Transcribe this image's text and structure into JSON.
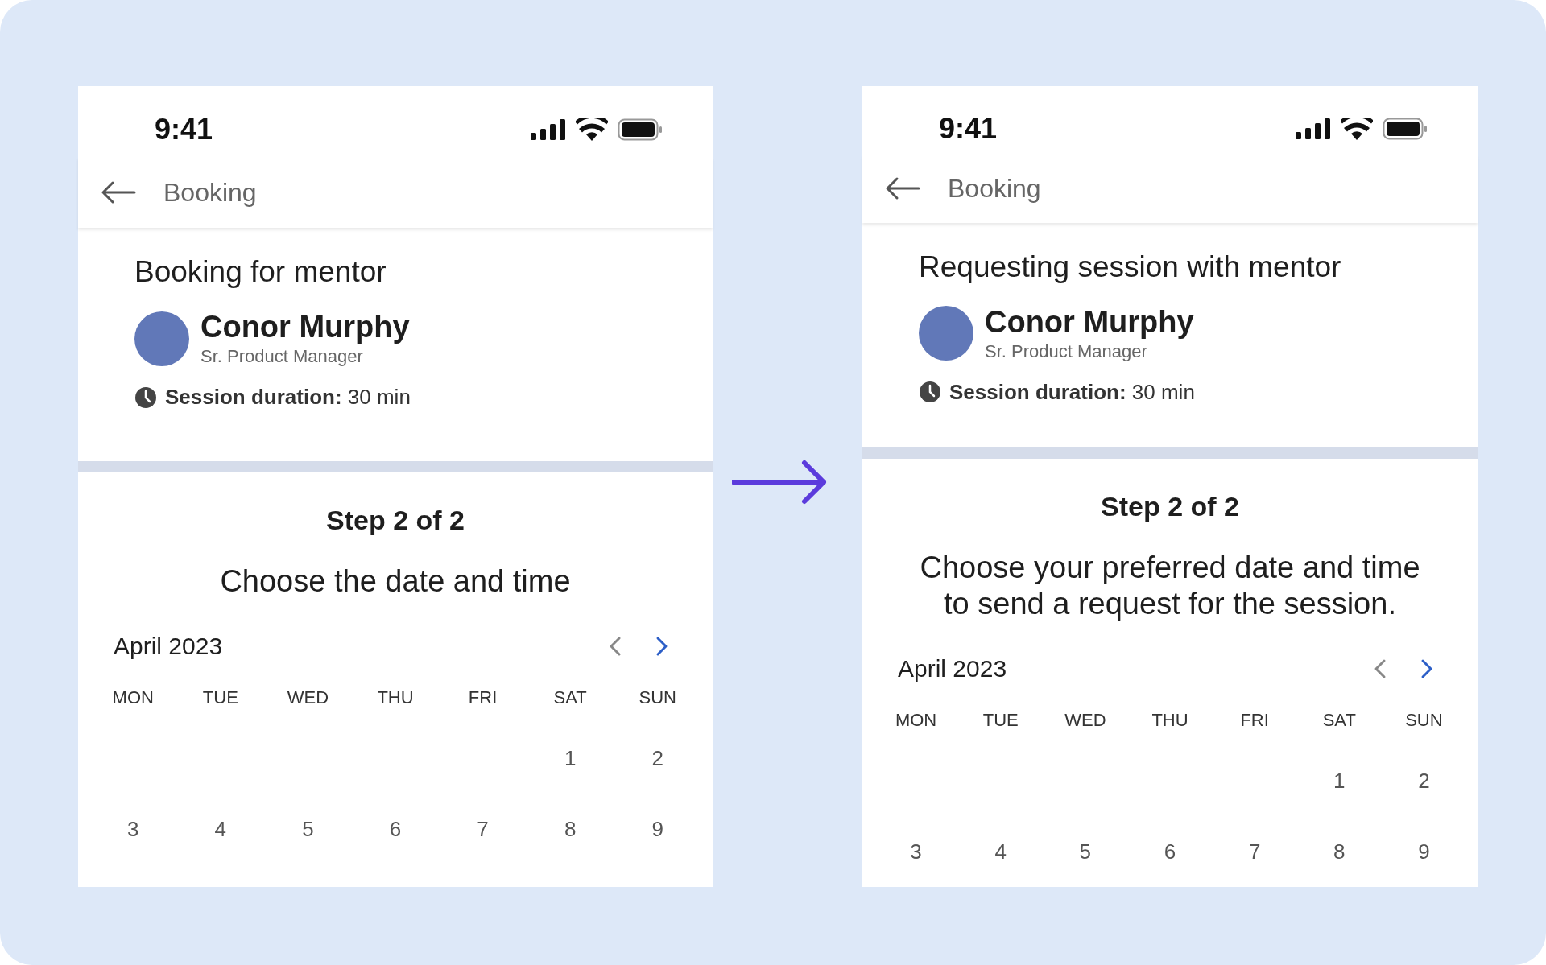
{
  "screens": [
    {
      "status_bar": {
        "time": "9:41"
      },
      "header": {
        "title": "Booking"
      },
      "heading": "Booking for mentor",
      "mentor": {
        "name": "Conor Murphy",
        "role": "Sr. Product Manager"
      },
      "duration": {
        "label": "Session duration:",
        "value": "30 min"
      },
      "step": "Step 2 of 2",
      "instruction": [
        "Choose the date and time"
      ],
      "calendar": {
        "month": "April 2023",
        "prev_enabled": false,
        "next_enabled": true,
        "weekdays": [
          "MON",
          "TUE",
          "WED",
          "THU",
          "FRI",
          "SAT",
          "SUN"
        ],
        "weeks": [
          {
            "kind": "partial",
            "days": [
              "1",
              "2"
            ]
          },
          {
            "kind": "full",
            "days": [
              "3",
              "4",
              "5",
              "6",
              "7",
              "8",
              "9"
            ]
          }
        ]
      }
    },
    {
      "status_bar": {
        "time": "9:41"
      },
      "header": {
        "title": "Booking"
      },
      "heading": "Requesting session with mentor",
      "mentor": {
        "name": "Conor Murphy",
        "role": "Sr. Product Manager"
      },
      "duration": {
        "label": "Session duration:",
        "value": "30 min"
      },
      "step": "Step 2 of 2",
      "instruction": [
        "Choose your preferred date and time",
        "to send a request for the session."
      ],
      "calendar": {
        "month": "April 2023",
        "prev_enabled": false,
        "next_enabled": true,
        "weekdays": [
          "MON",
          "TUE",
          "WED",
          "THU",
          "FRI",
          "SAT",
          "SUN"
        ],
        "weeks": [
          {
            "kind": "partial",
            "days": [
              "1",
              "2"
            ]
          },
          {
            "kind": "full",
            "days": [
              "3",
              "4",
              "5",
              "6",
              "7",
              "8",
              "9"
            ]
          }
        ]
      }
    }
  ]
}
